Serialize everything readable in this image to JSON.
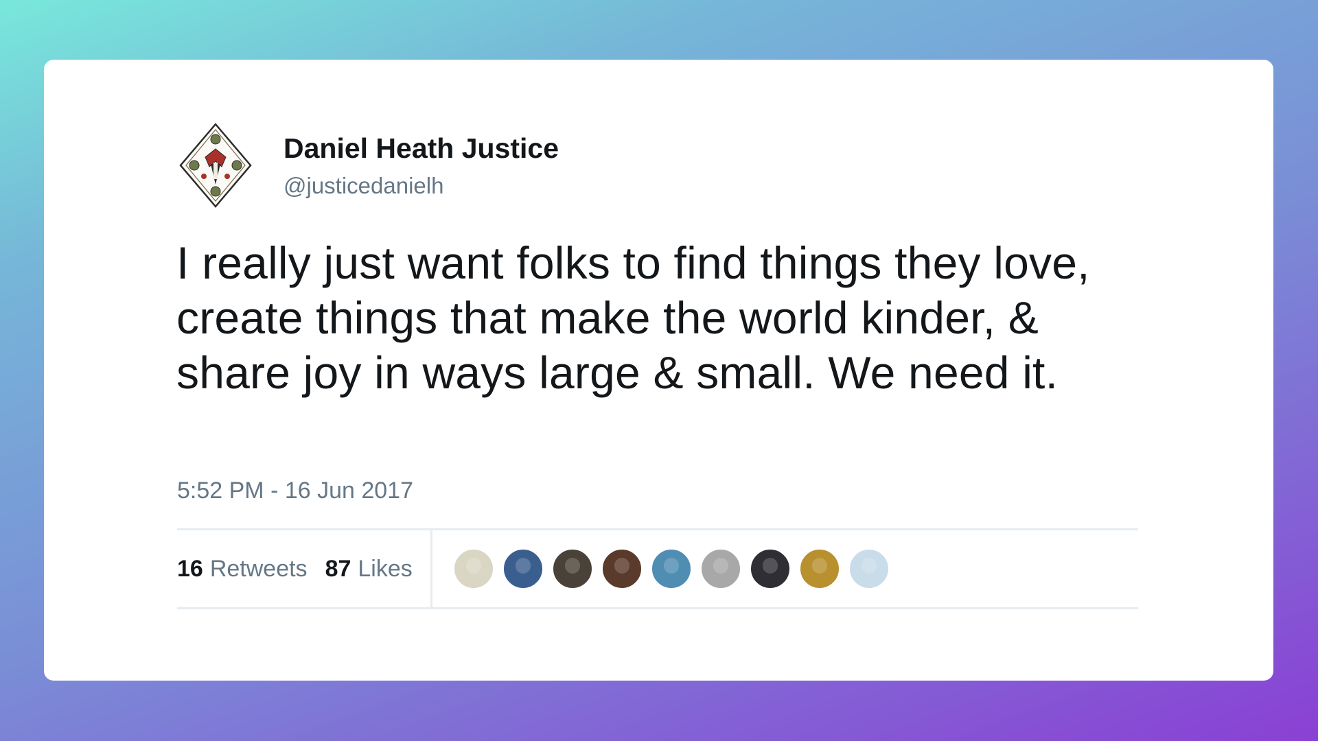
{
  "tweet": {
    "display_name": "Daniel Heath Justice",
    "handle": "@justicedanielh",
    "avatar_icon": "diamond-crest-avatar-icon",
    "text": "I really just want folks to find things they love, create things that make the world kinder, & share joy in ways large & small. We need it.",
    "timestamp": "5:52 PM - 16 Jun 2017"
  },
  "stats": {
    "retweets_count": "16",
    "retweets_label": "Retweets",
    "likes_count": "87",
    "likes_label": "Likes"
  },
  "likers": [
    {
      "name": "liker-avatar-1",
      "color": "#d9d6c4"
    },
    {
      "name": "liker-avatar-2",
      "color": "#3a5f8f"
    },
    {
      "name": "liker-avatar-3",
      "color": "#4a4238"
    },
    {
      "name": "liker-avatar-4",
      "color": "#5a3a2a"
    },
    {
      "name": "liker-avatar-5",
      "color": "#4f8db3"
    },
    {
      "name": "liker-avatar-6",
      "color": "#a8a8a8"
    },
    {
      "name": "liker-avatar-7",
      "color": "#2e2e34"
    },
    {
      "name": "liker-avatar-8",
      "color": "#b8902e"
    },
    {
      "name": "liker-avatar-9",
      "color": "#c9dcea"
    }
  ],
  "colors": {
    "card_background": "#ffffff",
    "primary_text": "#14171a",
    "secondary_text": "#657786",
    "divider": "#e6ecf0"
  }
}
